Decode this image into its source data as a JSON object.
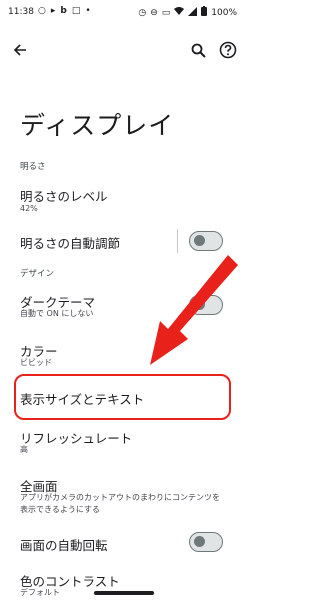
{
  "status_bar": {
    "time": "11:38",
    "left_icons": [
      "chat-icon",
      "video-icon",
      "b-icon",
      "bag-icon",
      "dot-icon"
    ],
    "battery_percent": "100%"
  },
  "app_bar": {
    "back_icon": "arrow-back-icon",
    "search_icon": "search-icon",
    "help_icon": "help-icon"
  },
  "page": {
    "title": "ディスプレイ"
  },
  "sections": {
    "brightness_header": "明るさ",
    "design_header": "デザイン"
  },
  "items": {
    "brightness_level": {
      "title": "明るさのレベル",
      "subtitle": "42%"
    },
    "auto_brightness": {
      "title": "明るさの自動調節",
      "toggle_on": false
    },
    "dark_theme": {
      "title": "ダークテーマ",
      "subtitle": "自動で ON にしない",
      "toggle_on": false
    },
    "color": {
      "title": "カラー",
      "subtitle": "ビビッド"
    },
    "display_size_text": {
      "title": "表示サイズとテキスト"
    },
    "refresh_rate": {
      "title": "リフレッシュレート",
      "subtitle": "高"
    },
    "full_screen": {
      "title": "全画面",
      "subtitle_line1": "アプリがカメラのカットアウトのまわりにコンテンツを",
      "subtitle_line2": "表示できるようにする"
    },
    "auto_rotate": {
      "title": "画面の自動回転",
      "toggle_on": false
    },
    "color_contrast": {
      "title": "色のコントラスト",
      "subtitle": "デフォルト"
    }
  },
  "annotations": {
    "highlight_color": "#e8221b",
    "arrow_color": "#e8221b"
  }
}
